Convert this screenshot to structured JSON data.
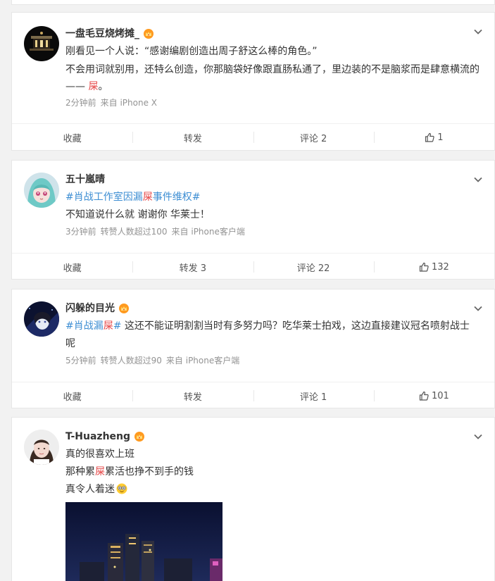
{
  "posts": [
    {
      "author": "一盘毛豆烧烤摊_",
      "lines": [
        {
          "text": "刚看见一个人说：“感谢编剧创造出周子舒这么棒的角色。”"
        },
        {
          "text": "不会用词就别用，还特么创造，你那脑袋好像跟直肠私通了，里边装的不是脑浆而是肆意横流的"
        },
        {
          "pre": "—— ",
          "red": "屎",
          "post": "。"
        }
      ],
      "meta": [
        "2分钟前",
        "来自 iPhone X"
      ],
      "actions": {
        "fav": "收藏",
        "repost": "转发",
        "comment": "评论 2",
        "like": "1"
      }
    },
    {
      "author": "五十嵐晴",
      "topic": {
        "pre": "#肖战工作室因漏",
        "red": "屎",
        "post": "事件维权#"
      },
      "lines": [
        {
          "text": "不知道说什么就 谢谢你 华莱士！"
        }
      ],
      "meta": [
        "3分钟前",
        "转赞人数超过100",
        "来自 iPhone客户端"
      ],
      "actions": {
        "fav": "收藏",
        "repost": "转发 3",
        "comment": "评论 22",
        "like": "132"
      }
    },
    {
      "author": "闪躲的目光",
      "line1": {
        "topic_pre": "#肖战漏",
        "red": "屎",
        "topic_post": "#",
        "post": " 这还不能证明割割当时有多努力吗？吃华莱士拍戏，这边直接建议冠名喷射战士"
      },
      "line2": "呢",
      "meta": [
        "5分钟前",
        "转赞人数超过90",
        "来自 iPhone客户端"
      ],
      "actions": {
        "fav": "收藏",
        "repost": "转发",
        "comment": "评论 1",
        "like": "101"
      }
    },
    {
      "author": "T-Huazheng",
      "lines": [
        {
          "text": "真的很喜欢上班"
        },
        {
          "pre": "那种累",
          "red": "屎",
          "post": "累活也挣不到手的钱"
        },
        {
          "text": "真令人着迷"
        }
      ],
      "emoji": "nerd-face-emoji"
    }
  ],
  "colors": {
    "accent_red": "#e64545",
    "topic_blue": "#3d8ed3",
    "meta_gray": "#939393"
  }
}
